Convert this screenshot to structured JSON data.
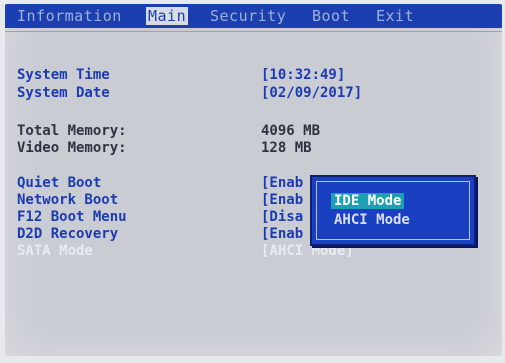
{
  "menu": [
    "Information",
    "Main",
    "Security",
    "Boot",
    "Exit"
  ],
  "active_menu": "Main",
  "rows": [
    {
      "label": "System Time",
      "value": "[10:32:49]"
    },
    {
      "label": "System Date",
      "value": "[02/09/2017]"
    },
    {
      "label": "Total Memory:",
      "value": "4096 MB"
    },
    {
      "label": "Video Memory:",
      "value": "128 MB"
    },
    {
      "label": "Quiet Boot",
      "value": "[Enab"
    },
    {
      "label": "Network Boot",
      "value": "[Enab"
    },
    {
      "label": "F12 Boot Menu",
      "value": "[Disa"
    },
    {
      "label": "D2D Recovery",
      "value": "[Enab"
    },
    {
      "label": "SATA Mode",
      "value": "[AHCI Mode]"
    }
  ],
  "popup": {
    "options": [
      "IDE Mode",
      "AHCI Mode"
    ],
    "selected": "IDE Mode"
  },
  "colors": {
    "bios_blue": "#1b3fb0",
    "highlight": "#1e9fb3",
    "background": "#c9ccd3"
  }
}
